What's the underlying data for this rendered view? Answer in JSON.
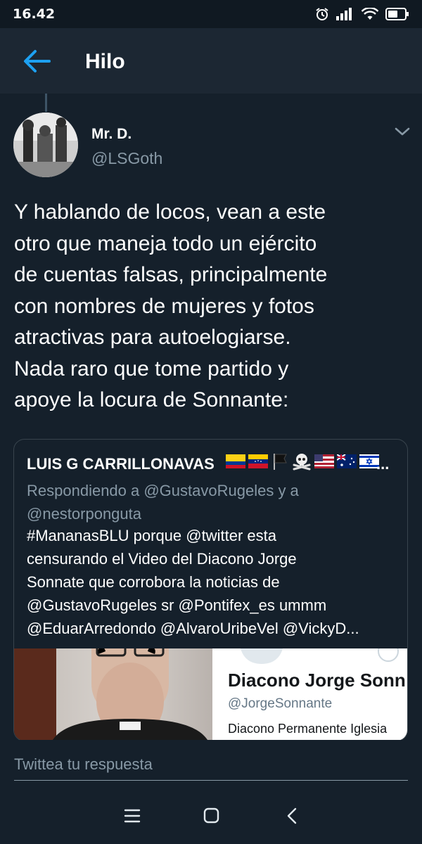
{
  "status_bar": {
    "time": "16.42",
    "icons": [
      "alarm-icon",
      "signal-icon",
      "wifi-icon",
      "battery-icon"
    ]
  },
  "header": {
    "back_icon": "back-arrow-icon",
    "title": "Hilo"
  },
  "tweet": {
    "author_name": "Mr. D.",
    "author_handle": "@LSGoth",
    "menu_icon": "chevron-down-icon",
    "text": "Y hablando de locos, vean a este\notro que maneja todo un ejército\nde cuentas falsas, principalmente\ncon nombres de mujeres y fotos\natractivas para autoelogiarse.\nNada raro que tome partido y\napoye la locura de Sonnante:"
  },
  "quoted_tweet": {
    "author_name": "LUIS G CARRILLONAVAS",
    "name_ellipsis": "...",
    "flags": [
      "colombia-flag-icon",
      "venezuela-flag-icon",
      "black-flag-icon",
      "skull-crossbones-icon",
      "usa-flag-icon",
      "australia-flag-icon",
      "israel-flag-icon"
    ],
    "replying_to": "Respondiendo a @GustavoRugeles y a @nestorponguta",
    "text_lines": [
      "#MananasBLU porque @twitter esta",
      "censurando el Video del Diacono Jorge",
      "Sonnate que corrobora la noticias de",
      "@GustavoRugeles sr @Pontifex_es ummm",
      "@EduarArredondo @AlvaroUribeVel @VickyD..."
    ],
    "media": {
      "profile_title": "Diacono Jorge Sonn",
      "profile_handle": "@JorgeSonnante",
      "profile_bio": "Diacono Permanente Iglesia"
    }
  },
  "composer": {
    "placeholder": "Twittea tu respuesta"
  },
  "nav_bar": {
    "icons": [
      "menu-icon",
      "home-square-icon",
      "back-chevron-icon"
    ]
  },
  "colors": {
    "background": "#15202b",
    "header": "#1c2733",
    "accent": "#1da1f2",
    "secondary_text": "#8899a6",
    "border": "#38444d"
  }
}
